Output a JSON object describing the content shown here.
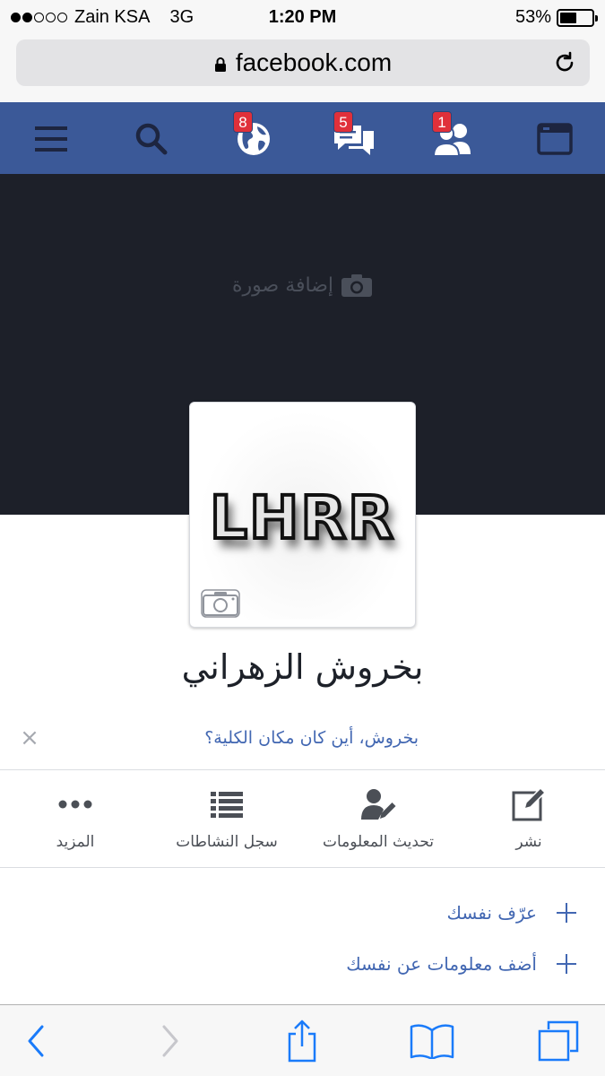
{
  "status_bar": {
    "carrier": "Zain KSA",
    "network": "3G",
    "time": "1:20 PM",
    "battery_text": "53%",
    "battery_level": 0.53,
    "signal_bars_filled": 2,
    "signal_bars_total": 5
  },
  "browser": {
    "url": "facebook.com"
  },
  "fb_nav": {
    "items": [
      {
        "icon": "menu-icon",
        "badge": ""
      },
      {
        "icon": "search-icon",
        "badge": ""
      },
      {
        "icon": "globe-icon",
        "badge": "8"
      },
      {
        "icon": "messages-icon",
        "badge": "5"
      },
      {
        "icon": "friend-requests-icon",
        "badge": "1"
      },
      {
        "icon": "news-feed-icon",
        "badge": ""
      }
    ],
    "color": "#3b5998"
  },
  "cover": {
    "add_photo_label": "إضافة صورة"
  },
  "profile": {
    "picture_text": "LHRR",
    "name": "بخروش الزهراني"
  },
  "prompt": {
    "text": "بخروش، أين كان مكان الكلية؟"
  },
  "actions": {
    "post": "نشر",
    "update_info": "تحديث المعلومات",
    "activity_log": "سجل النشاطات",
    "more": "المزيد"
  },
  "about": {
    "items": [
      {
        "label": "عرّف نفسك"
      },
      {
        "label": "أضف معلومات عن نفسك"
      }
    ]
  },
  "colors": {
    "link_blue": "#4267b2",
    "cover_dark": "#1d2029",
    "badge_red": "#e0303a",
    "ios_blue": "#1a7bfa"
  }
}
